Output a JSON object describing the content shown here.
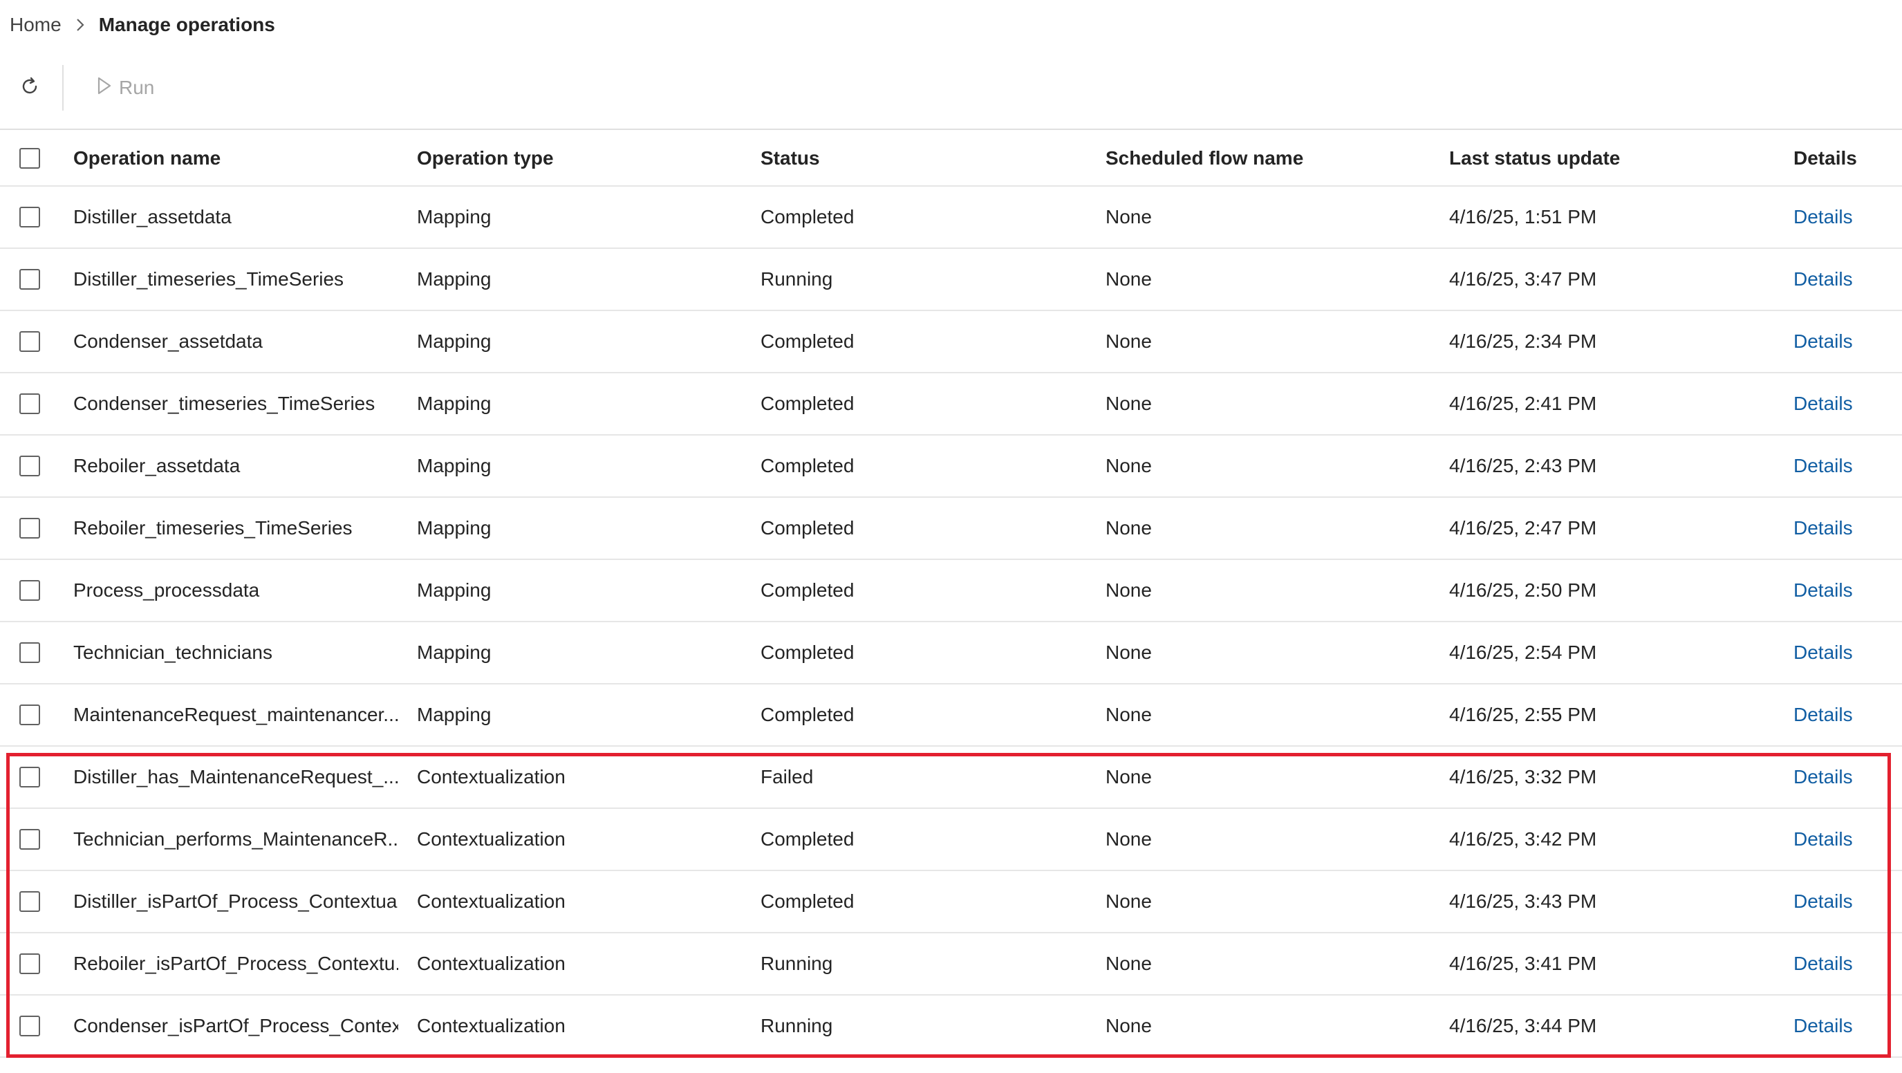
{
  "breadcrumb": {
    "home": "Home",
    "current": "Manage operations"
  },
  "toolbar": {
    "run_label": "Run",
    "refresh_icon": "refresh-icon",
    "run_icon": "play-icon"
  },
  "table": {
    "headers": {
      "name": "Operation name",
      "type": "Operation type",
      "status": "Status",
      "flow": "Scheduled flow name",
      "update": "Last status update",
      "details": "Details"
    },
    "rows": [
      {
        "name": "Distiller_assetdata",
        "type": "Mapping",
        "status": "Completed",
        "flow": "None",
        "update": "4/16/25, 1:51 PM",
        "details": "Details"
      },
      {
        "name": "Distiller_timeseries_TimeSeries",
        "type": "Mapping",
        "status": "Running",
        "flow": "None",
        "update": "4/16/25, 3:47 PM",
        "details": "Details"
      },
      {
        "name": "Condenser_assetdata",
        "type": "Mapping",
        "status": "Completed",
        "flow": "None",
        "update": "4/16/25, 2:34 PM",
        "details": "Details"
      },
      {
        "name": "Condenser_timeseries_TimeSeries",
        "type": "Mapping",
        "status": "Completed",
        "flow": "None",
        "update": "4/16/25, 2:41 PM",
        "details": "Details"
      },
      {
        "name": "Reboiler_assetdata",
        "type": "Mapping",
        "status": "Completed",
        "flow": "None",
        "update": "4/16/25, 2:43 PM",
        "details": "Details"
      },
      {
        "name": "Reboiler_timeseries_TimeSeries",
        "type": "Mapping",
        "status": "Completed",
        "flow": "None",
        "update": "4/16/25, 2:47 PM",
        "details": "Details"
      },
      {
        "name": "Process_processdata",
        "type": "Mapping",
        "status": "Completed",
        "flow": "None",
        "update": "4/16/25, 2:50 PM",
        "details": "Details"
      },
      {
        "name": "Technician_technicians",
        "type": "Mapping",
        "status": "Completed",
        "flow": "None",
        "update": "4/16/25, 2:54 PM",
        "details": "Details"
      },
      {
        "name": "MaintenanceRequest_maintenancer...",
        "type": "Mapping",
        "status": "Completed",
        "flow": "None",
        "update": "4/16/25, 2:55 PM",
        "details": "Details"
      },
      {
        "name": "Distiller_has_MaintenanceRequest_...",
        "type": "Contextualization",
        "status": "Failed",
        "flow": "None",
        "update": "4/16/25, 3:32 PM",
        "details": "Details"
      },
      {
        "name": "Technician_performs_MaintenanceR...",
        "type": "Contextualization",
        "status": "Completed",
        "flow": "None",
        "update": "4/16/25, 3:42 PM",
        "details": "Details"
      },
      {
        "name": "Distiller_isPartOf_Process_Contextua...",
        "type": "Contextualization",
        "status": "Completed",
        "flow": "None",
        "update": "4/16/25, 3:43 PM",
        "details": "Details"
      },
      {
        "name": "Reboiler_isPartOf_Process_Contextu...",
        "type": "Contextualization",
        "status": "Running",
        "flow": "None",
        "update": "4/16/25, 3:41 PM",
        "details": "Details"
      },
      {
        "name": "Condenser_isPartOf_Process_Contex...",
        "type": "Contextualization",
        "status": "Running",
        "flow": "None",
        "update": "4/16/25, 3:44 PM",
        "details": "Details"
      }
    ]
  },
  "colors": {
    "highlight": "#e3202f",
    "link": "#115ea3",
    "disabled": "#a6a6a6"
  }
}
